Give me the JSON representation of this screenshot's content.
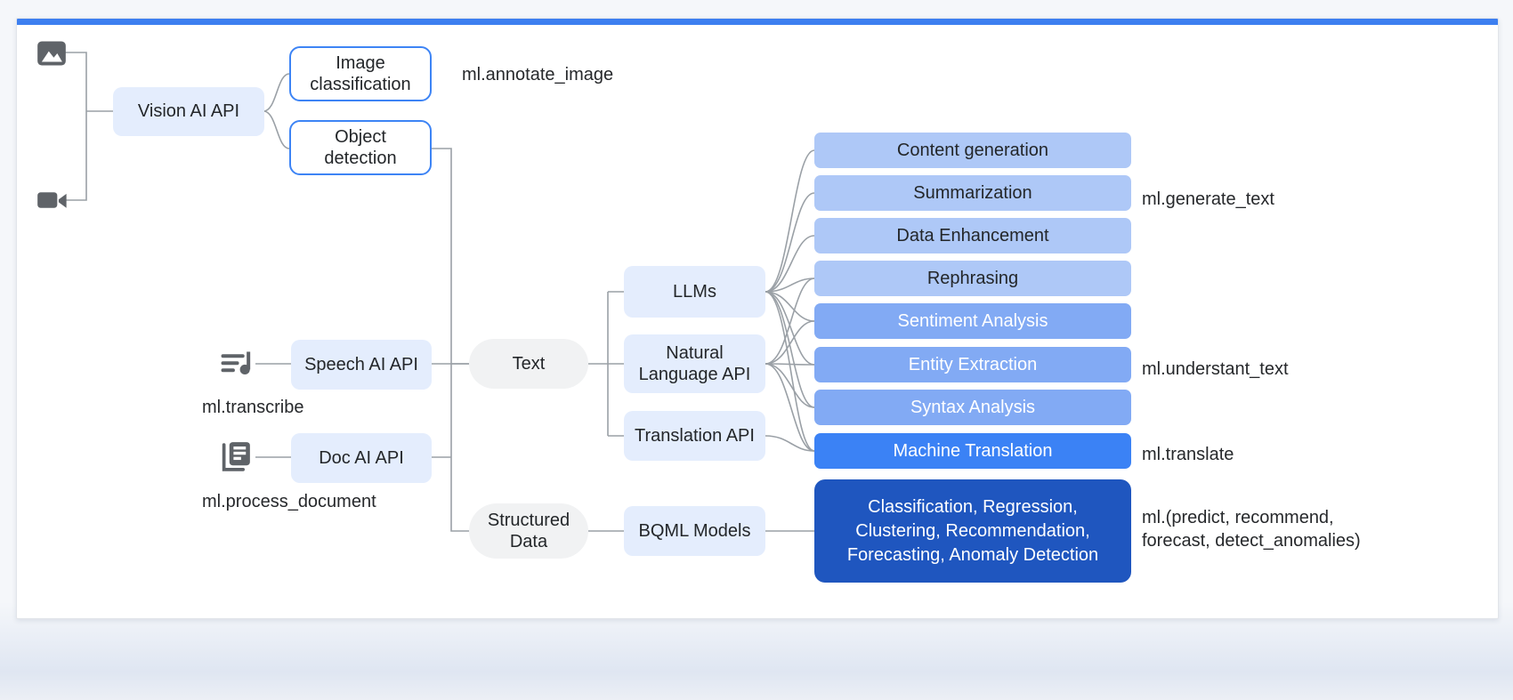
{
  "theme": {
    "accent_bar": "#3d7ff0",
    "light_node": "#e4edfd",
    "outline_node_border": "#3d84f5",
    "pill_node": "#f1f2f3",
    "bar_level1": "#aec8f7",
    "bar_level2": "#82aaf4",
    "bar_level3": "#3b82f5",
    "bar_level4": "#1f56bf",
    "connector": "#9aa0a6",
    "icon": "#5f6368"
  },
  "sources": [
    {
      "id": "image",
      "icon": "image-icon"
    },
    {
      "id": "video",
      "icon": "video-camera-icon"
    },
    {
      "id": "audio",
      "icon": "audio-waveform-icon",
      "caption": "ml.transcribe"
    },
    {
      "id": "document",
      "icon": "document-icon",
      "caption": "ml.process_document"
    }
  ],
  "apis": [
    {
      "id": "vision",
      "label": "Vision AI API"
    },
    {
      "id": "speech",
      "label": "Speech AI API"
    },
    {
      "id": "doc",
      "label": "Doc AI API"
    }
  ],
  "vision_outputs": [
    {
      "id": "image-classification",
      "label": "Image\nclassification"
    },
    {
      "id": "object-detection",
      "label": "Object\ndetection"
    }
  ],
  "data_types": [
    {
      "id": "text",
      "label": "Text"
    },
    {
      "id": "structured-data",
      "label": "Structured\nData"
    }
  ],
  "models": [
    {
      "id": "llms",
      "label": "LLMs"
    },
    {
      "id": "natural-language-api",
      "label": "Natural\nLanguage API"
    },
    {
      "id": "translation-api",
      "label": "Translation API"
    },
    {
      "id": "bqml-models",
      "label": "BQML Models"
    }
  ],
  "capabilities": [
    {
      "id": "content-generation",
      "label": "Content generation",
      "tier": "bar-l1"
    },
    {
      "id": "summarization",
      "label": "Summarization",
      "tier": "bar-l1"
    },
    {
      "id": "data-enhancement",
      "label": "Data Enhancement",
      "tier": "bar-l1"
    },
    {
      "id": "rephrasing",
      "label": "Rephrasing",
      "tier": "bar-l1"
    },
    {
      "id": "sentiment-analysis",
      "label": "Sentiment Analysis",
      "tier": "bar-l2"
    },
    {
      "id": "entity-extraction",
      "label": "Entity Extraction",
      "tier": "bar-l2"
    },
    {
      "id": "syntax-analysis",
      "label": "Syntax Analysis",
      "tier": "bar-l2"
    },
    {
      "id": "machine-translation",
      "label": "Machine Translation",
      "tier": "bar-l3"
    },
    {
      "id": "bqml-tasks",
      "label": "Classification, Regression,\nClustering, Recommendation,\nForecasting, Anomaly Detection",
      "tier": "bar-l4"
    }
  ],
  "function_labels": [
    {
      "id": "annotate-image",
      "text": "ml.annotate_image"
    },
    {
      "id": "generate-text",
      "text": "ml.generate_text"
    },
    {
      "id": "understant-text",
      "text": "ml.understant_text"
    },
    {
      "id": "translate",
      "text": "ml.translate"
    },
    {
      "id": "bqml-functions",
      "text": "ml.(predict, recommend,\nforecast, detect_anomalies)"
    }
  ]
}
